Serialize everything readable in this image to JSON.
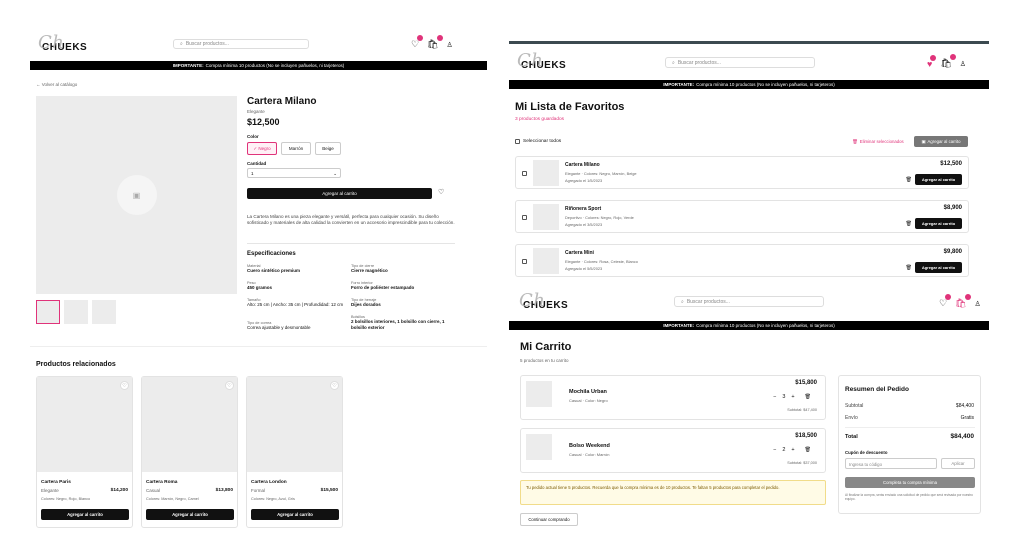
{
  "brand": {
    "name": "CHUEKS",
    "script": "Ch"
  },
  "search_placeholder": "Buscar productos...",
  "banner": {
    "strong": "IMPORTANTE:",
    "text": "Compra mínima 10 productos (No se incluyen pañuelos, ni tarjeteros)"
  },
  "product": {
    "back_link": "← Volver al catálogo",
    "title": "Cartera Milano",
    "category": "Elegante",
    "price": "$12,500",
    "color_label": "Color",
    "colors": [
      "✓ Negro",
      "Marrón",
      "Beige"
    ],
    "quantity_label": "Cantidad",
    "quantity_value": "1",
    "add_to_cart": "Agregar al carrito",
    "description": "La Cartera Milano es una pieza elegante y versátil, perfecta para cualquier ocasión. Su diseño sofisticado y materiales de alta calidad la convierten en un accesorio imprescindible para tu colección.",
    "specs_title": "Especificaciones",
    "specs": [
      {
        "label": "Material",
        "value": "Cuero sintético premium"
      },
      {
        "label": "Tipo de cierre",
        "value": "Cierre magnético"
      },
      {
        "label": "Peso",
        "value": "450 gramos"
      },
      {
        "label": "Forro interior",
        "value": "Forro de poliéster estampado"
      },
      {
        "label": "Tamaño",
        "value": "Alto: 25 cm | Ancho: 35 cm | Profundidad: 12 cm"
      },
      {
        "label": "Tipo de herraje",
        "value": "Dijes dorados"
      },
      {
        "label": "Tipo de correa",
        "value": "Correa ajustable y desmontable"
      },
      {
        "label": "Bolsillos",
        "value": "2 bolsillos interiores, 1 bolsillo con cierre, 1 bolsillo exterior"
      }
    ],
    "related_title": "Productos relacionados",
    "related": [
      {
        "name": "Cartera Paris",
        "category": "Elegante",
        "price": "$14,200",
        "colors": "Colores: Negro, Rojo, Blanco",
        "button": "Agregar al carrito"
      },
      {
        "name": "Cartera Roma",
        "category": "Casual",
        "price": "$13,800",
        "colors": "Colores: Marrón, Negro, Camel",
        "button": "Agregar al carrito"
      },
      {
        "name": "Cartera London",
        "category": "Formal",
        "price": "$15,500",
        "colors": "Colores: Negro, Azul, Gris",
        "button": "Agregar al carrito"
      }
    ]
  },
  "favorites": {
    "title": "Mi Lista de Favoritos",
    "subtitle": "3 productos guardados",
    "select_all": "Seleccionar todos",
    "delete_selected": "Eliminar seleccionados",
    "add_to_cart_bulk": "Agregar al carrito",
    "items": [
      {
        "name": "Cartera Milano",
        "meta": "Elegante · Colores: Negro, Marrón, Beige",
        "date": "Agregado el 1/5/2023",
        "price": "$12,500",
        "button": "Agregar al carrito"
      },
      {
        "name": "Riñonera Sport",
        "meta": "Deportivo · Colores: Negro, Rojo, Verde",
        "date": "Agregado el 3/5/2023",
        "price": "$8,900",
        "button": "Agregar al carrito"
      },
      {
        "name": "Cartera Mini",
        "meta": "Elegante · Colores: Rosa, Celeste, Blanco",
        "date": "Agregado el 5/5/2023",
        "price": "$9,800",
        "button": "Agregar al carrito"
      }
    ]
  },
  "cart": {
    "title": "Mi Carrito",
    "subtitle": "5 productos en tu carrito",
    "items": [
      {
        "name": "Mochila Urban",
        "meta": "Casual · Color: Negro",
        "price": "$15,800",
        "qty": "3",
        "subtotal": "Subtotal: $47,400"
      },
      {
        "name": "Bolso Weekend",
        "meta": "Casual · Color: Marrón",
        "price": "$18,500",
        "qty": "2",
        "subtotal": "Subtotal: $37,000"
      }
    ],
    "warning": "Tu pedido actual tiene 5 productos. Recuerda que la compra mínima es de 10 productos. Te faltan 5 productos para completar el pedido.",
    "continue": "Continuar comprando",
    "summary": {
      "title": "Resumen del Pedido",
      "subtotal_label": "Subtotal",
      "subtotal_value": "$84,400",
      "shipping_label": "Envío",
      "shipping_value": "Gratis",
      "total_label": "Total",
      "total_value": "$84,400",
      "coupon_label": "Cupón de descuento",
      "coupon_placeholder": "Ingresa tu código",
      "apply": "Aplicar",
      "checkout": "Completa tu compra mínima",
      "note": "Al finalizar la compra, serás enviado una solicitud de pedido que será revisada por nuestro equipo."
    }
  },
  "colors": {
    "accent": "#e0337a",
    "black": "#111111",
    "warning_bg": "#fffbe6"
  }
}
